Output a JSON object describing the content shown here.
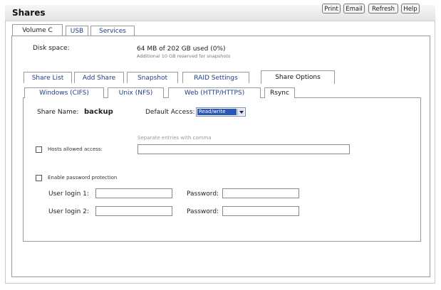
{
  "window": {
    "title": "Shares"
  },
  "toolbar": {
    "print": "Print",
    "email": "Email",
    "refresh": "Refresh",
    "help": "Help"
  },
  "volume_tabs": [
    "Volume C",
    "USB",
    "Services"
  ],
  "disk": {
    "label": "Disk space:",
    "value": "64 MB of 202 GB used (0%)",
    "note": "Additional 10 GB reserved for snapshots"
  },
  "share_tabs": [
    "Share List",
    "Add Share",
    "Snapshot",
    "RAID Settings",
    "Share Options"
  ],
  "protocol_tabs": [
    "Windows (CIFS)",
    "Unix (NFS)",
    "Web (HTTP/HTTPS)",
    "Rsync"
  ],
  "share": {
    "name_label": "Share Name:",
    "name_value": "backup",
    "access_label": "Default Access:",
    "access_value": "Read/write"
  },
  "hosts": {
    "hint": "Separate entries with comma",
    "label": "Hosts allowed access:",
    "value": ""
  },
  "password": {
    "label": "Enable password protection",
    "login1_label": "User login 1:",
    "login2_label": "User login 2:",
    "pw_label": "Password:"
  }
}
